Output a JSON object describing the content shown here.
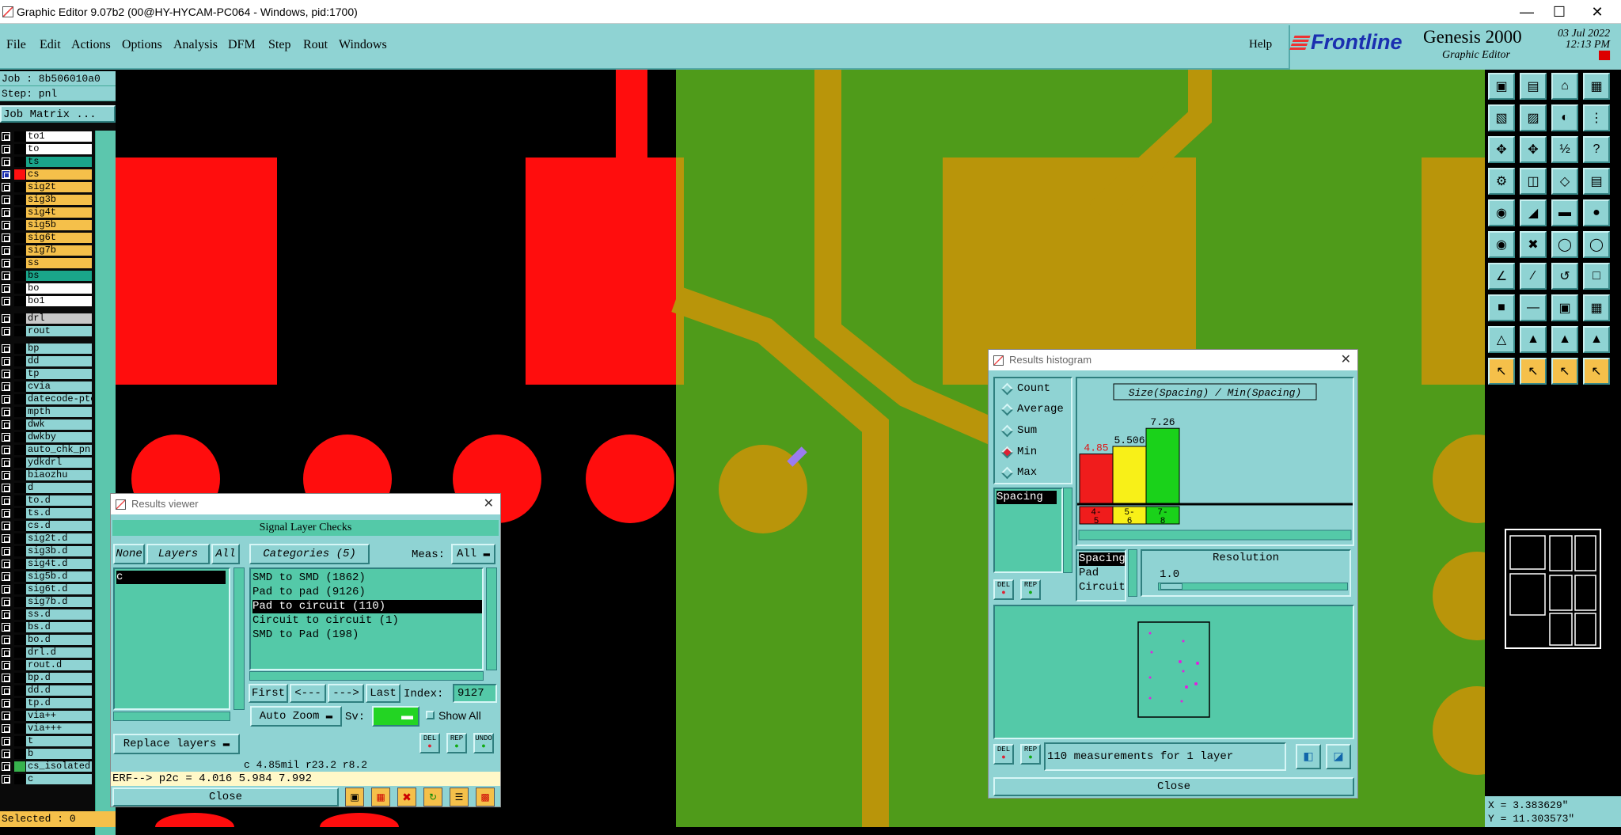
{
  "window": {
    "title": "Graphic Editor 9.07b2 (00@HY-HYCAM-PC064 - Windows, pid:1700)"
  },
  "menu": [
    "File",
    "Edit",
    "Actions",
    "Options",
    "Analysis",
    "DFM",
    "Step",
    "Rout",
    "Windows"
  ],
  "help_label": "Help",
  "brand": {
    "logo": "Frontline",
    "product": "Genesis 2000",
    "subtitle": "Graphic Editor",
    "date": "03 Jul 2022",
    "time": "12:13 PM"
  },
  "job": {
    "job_line": "Job : 8b506010a0",
    "step_line": "Step: pnl",
    "matrix_button": "Job Matrix ..."
  },
  "layers": [
    {
      "name": "to1",
      "color": "#ffffff",
      "swatch": "#000000"
    },
    {
      "name": "to",
      "color": "#ffffff",
      "swatch": "#000000"
    },
    {
      "name": "ts",
      "color": "#1aa58a",
      "swatch": "#000000"
    },
    {
      "name": "cs",
      "color": "#f5c04a",
      "swatch": "#ff1010",
      "selected": true
    },
    {
      "name": "sig2t",
      "color": "#f5c04a",
      "swatch": "#000000"
    },
    {
      "name": "sig3b",
      "color": "#f5c04a",
      "swatch": "#000000"
    },
    {
      "name": "sig4t",
      "color": "#f5c04a",
      "swatch": "#000000"
    },
    {
      "name": "sig5b",
      "color": "#f5c04a",
      "swatch": "#000000"
    },
    {
      "name": "sig6t",
      "color": "#f5c04a",
      "swatch": "#000000"
    },
    {
      "name": "sig7b",
      "color": "#f5c04a",
      "swatch": "#000000"
    },
    {
      "name": "ss",
      "color": "#f5c04a",
      "swatch": "#000000"
    },
    {
      "name": "bs",
      "color": "#1aa58a",
      "swatch": "#000000"
    },
    {
      "name": "bo",
      "color": "#ffffff",
      "swatch": "#000000"
    },
    {
      "name": "bo1",
      "color": "#ffffff",
      "swatch": "#000000"
    },
    {
      "name": "drl",
      "color": "#c8c8c8",
      "swatch": "#000000"
    },
    {
      "name": "rout",
      "color": "#8fd3d3",
      "swatch": "#000000"
    },
    {
      "name": "bp",
      "color": "#8fd3d3",
      "swatch": "#000000"
    },
    {
      "name": "dd",
      "color": "#8fd3d3",
      "swatch": "#000000"
    },
    {
      "name": "tp",
      "color": "#8fd3d3",
      "swatch": "#000000"
    },
    {
      "name": "cvia",
      "color": "#8fd3d3",
      "swatch": "#000000"
    },
    {
      "name": "datecode-ptc",
      "color": "#8fd3d3",
      "swatch": "#000000"
    },
    {
      "name": "mpth",
      "color": "#8fd3d3",
      "swatch": "#000000"
    },
    {
      "name": "dwk",
      "color": "#8fd3d3",
      "swatch": "#000000"
    },
    {
      "name": "dwkby",
      "color": "#8fd3d3",
      "swatch": "#000000"
    },
    {
      "name": "auto_chk_pn",
      "color": "#8fd3d3",
      "swatch": "#000000"
    },
    {
      "name": "ydkdrl",
      "color": "#8fd3d3",
      "swatch": "#000000"
    },
    {
      "name": "biaozhu",
      "color": "#8fd3d3",
      "swatch": "#000000"
    },
    {
      "name": "d",
      "color": "#8fd3d3",
      "swatch": "#000000"
    },
    {
      "name": "to.d",
      "color": "#8fd3d3",
      "swatch": "#000000"
    },
    {
      "name": "ts.d",
      "color": "#8fd3d3",
      "swatch": "#000000"
    },
    {
      "name": "cs.d",
      "color": "#8fd3d3",
      "swatch": "#000000"
    },
    {
      "name": "sig2t.d",
      "color": "#8fd3d3",
      "swatch": "#000000"
    },
    {
      "name": "sig3b.d",
      "color": "#8fd3d3",
      "swatch": "#000000"
    },
    {
      "name": "sig4t.d",
      "color": "#8fd3d3",
      "swatch": "#000000"
    },
    {
      "name": "sig5b.d",
      "color": "#8fd3d3",
      "swatch": "#000000"
    },
    {
      "name": "sig6t.d",
      "color": "#8fd3d3",
      "swatch": "#000000"
    },
    {
      "name": "sig7b.d",
      "color": "#8fd3d3",
      "swatch": "#000000"
    },
    {
      "name": "ss.d",
      "color": "#8fd3d3",
      "swatch": "#000000"
    },
    {
      "name": "bs.d",
      "color": "#8fd3d3",
      "swatch": "#000000"
    },
    {
      "name": "bo.d",
      "color": "#8fd3d3",
      "swatch": "#000000"
    },
    {
      "name": "drl.d",
      "color": "#8fd3d3",
      "swatch": "#000000"
    },
    {
      "name": "rout.d",
      "color": "#8fd3d3",
      "swatch": "#000000"
    },
    {
      "name": "bp.d",
      "color": "#8fd3d3",
      "swatch": "#000000"
    },
    {
      "name": "dd.d",
      "color": "#8fd3d3",
      "swatch": "#000000"
    },
    {
      "name": "tp.d",
      "color": "#8fd3d3",
      "swatch": "#000000"
    },
    {
      "name": "via++",
      "color": "#8fd3d3",
      "swatch": "#000000"
    },
    {
      "name": "via+++",
      "color": "#8fd3d3",
      "swatch": "#000000"
    },
    {
      "name": "t",
      "color": "#8fd3d3",
      "swatch": "#000000"
    },
    {
      "name": "b",
      "color": "#8fd3d3",
      "swatch": "#000000"
    },
    {
      "name": "cs_isolated",
      "color": "#8fd3d3",
      "swatch": "#37b24d"
    },
    {
      "name": "c",
      "color": "#8fd3d3",
      "swatch": "#000000"
    }
  ],
  "selected_text": "Selected : 0",
  "coords": {
    "x": "X = 3.383629\"",
    "y": "Y = 11.303573\""
  },
  "results_viewer": {
    "title": "Results viewer",
    "header": "Signal Layer Checks",
    "none_btn": "None",
    "layers_btn": "Layers",
    "all_btn": "All",
    "categories_btn": "Categories (5)",
    "meas_label": "Meas:",
    "meas_value": "All",
    "layer_list": [
      "c"
    ],
    "categories": [
      "SMD to SMD (1862)",
      "Pad to pad (9126)",
      "Pad to circuit (110)",
      "Circuit to circuit (1)",
      "SMD to Pad (198)"
    ],
    "selected_category": "Pad to circuit (110)",
    "nav": {
      "first": "First",
      "prev": "<---",
      "next": "--->",
      "last": "Last",
      "index_label": "Index:",
      "index_value": "9127"
    },
    "zoom": "Auto Zoom",
    "sv_label": "Sv:",
    "show_all": "Show All",
    "replace": "Replace layers",
    "status": "c 4.85mil  r23.2  r8.2",
    "erf": "ERF--> p2c = 4.016 5.984 7.992",
    "close": "Close",
    "small_btns": [
      "DEL",
      "REP",
      "UNDO"
    ]
  },
  "results_histogram": {
    "title": "Results histogram",
    "stats": [
      "Count",
      "Average",
      "Sum",
      "Min",
      "Max"
    ],
    "selected_stat": "Min",
    "measure_list": [
      "Spacing"
    ],
    "chart_title": "Size(Spacing) / Min(Spacing)",
    "resolution_label": "Resolution",
    "resolution_value": "1.0",
    "type_list": [
      "Spacing",
      "Pad",
      "Circuit"
    ],
    "summary": "110 measurements for 1 layer",
    "close": "Close",
    "small_btns": [
      "DEL",
      "REP"
    ]
  },
  "chart_data": {
    "type": "bar",
    "title": "Size(Spacing) / Min(Spacing)",
    "categories": [
      "4-5",
      "5-6",
      "7-8"
    ],
    "values": [
      4.85,
      5.506,
      7.26
    ],
    "value_labels": [
      "4.85",
      "5.506",
      "7.26"
    ],
    "colors": [
      "#f01c1c",
      "#f8f018",
      "#1ad21a"
    ]
  }
}
